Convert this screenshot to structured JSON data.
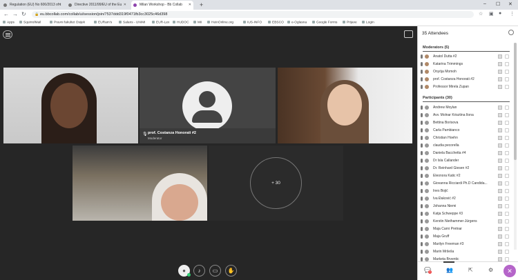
{
  "browser": {
    "tabs": [
      {
        "title": "Regulation (EU) No 606/2013 of t",
        "active": false
      },
      {
        "title": "Directive 2011/99/EU of the Eu",
        "active": false
      },
      {
        "title": "Milan Workshop - Bb Collab",
        "active": true
      }
    ],
    "url": "eu.bbcollab.com/collab/ui/session/join/7537ddd319f0471fb3cc3025c46d398",
    "bookmarks": [
      "Apps",
      "SquirrelMail",
      "Pravni fakultet Osijek",
      "EURam's",
      "Salans - UNIMI",
      "EUR-Lex",
      "HUDOC",
      "MiI",
      "HeinOnline.org",
      "IUS-INFO",
      "EBSCO",
      "e-Oglasna",
      "Google Forms",
      "Prijave",
      "Login"
    ]
  },
  "conference": {
    "presenter": {
      "name": "prof. Costanza Honorati #2",
      "role": "Moderator"
    },
    "overflow_label": "+ 30"
  },
  "panel": {
    "title": "35 Attendees",
    "moderators_heading": "Moderators (5)",
    "moderators": [
      "Anatol Dutta #2",
      "Katarina Trimmings",
      "Onyója Momoh",
      "prof. Costanza Honorati #2",
      "Professor Mirela Župan"
    ],
    "participants_heading": "Participants (30)",
    "participants": [
      "Andrew Moylan",
      "Avv. Molnar Krisztina Ilona",
      "Bettina Borisova",
      "Carla Pambianco",
      "Christian Hoehn",
      "claudia pecorella",
      "Daniela Bacchetta #4",
      "Dr Isla Callander",
      "Dr. Reinhard Giesen #2",
      "Eleonora Katic #2",
      "Giovanna Ricciardi Ph.D Candida...",
      "Ines Bojić",
      "Iva Đaković #2",
      "Johanna Niemi",
      "Katja Schweppe #3",
      "Kerstin Niethammer-Jürgens",
      "Maja Čarni Pretnar",
      "Maja Gruff",
      "Marilyn Freeman #3",
      "Marin Mršeša",
      "Marketa Brventic"
    ],
    "chat_badge": "1"
  },
  "icons": {
    "menu": "hamburger-icon",
    "layout": "layout-icon",
    "mic": "microphone-icon",
    "camera": "camera-icon",
    "hand": "raise-hand-icon",
    "chat": "chat-icon",
    "attendees": "attendees-icon",
    "share": "share-icon",
    "settings": "gear-icon",
    "close": "close-icon"
  }
}
